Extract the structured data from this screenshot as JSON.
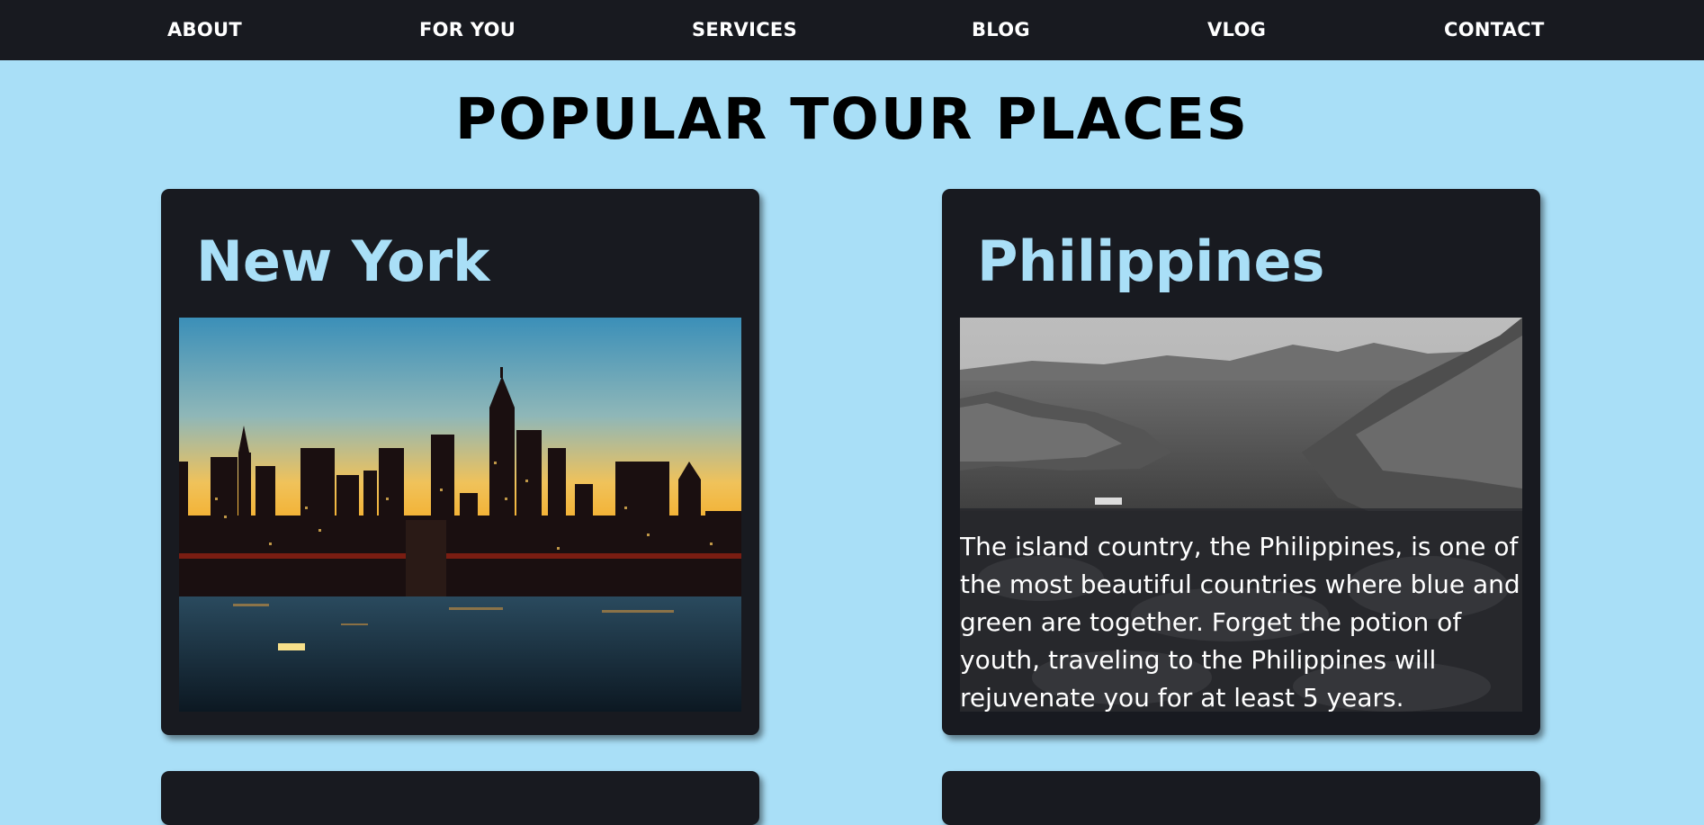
{
  "nav": {
    "items": [
      {
        "label": "ABOUT"
      },
      {
        "label": "FOR YOU"
      },
      {
        "label": "SERVICES"
      },
      {
        "label": "BLOG"
      },
      {
        "label": "VLOG"
      },
      {
        "label": "CONTACT"
      }
    ]
  },
  "page": {
    "title": "POPULAR TOUR PLACES"
  },
  "places": [
    {
      "name": "New York",
      "image": "new-york-skyline-at-sunset"
    },
    {
      "name": "Philippines",
      "image": "philippines-islands-black-and-white",
      "description": "The island country, the Philippines, is one of the most beautiful countries where blue and green are together. Forget the potion of youth, traveling to the Philippines will rejuvenate you for at least 5 years."
    }
  ],
  "colors": {
    "background": "#a9dff7",
    "navbar": "#181a20",
    "card": "#181a20",
    "card_title": "#a9dff7"
  }
}
